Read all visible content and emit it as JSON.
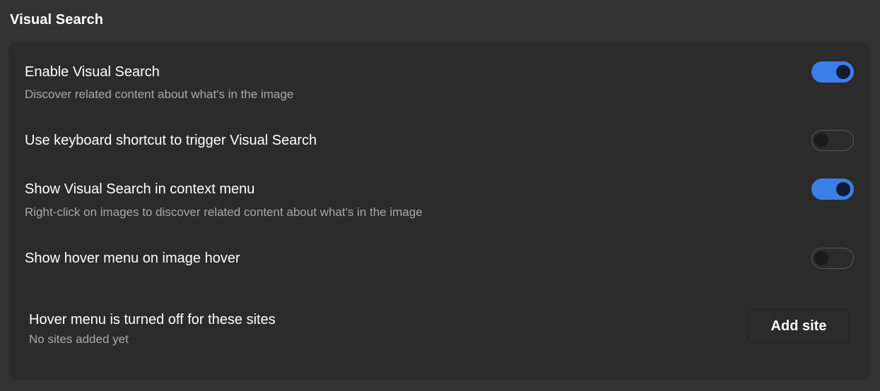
{
  "section": {
    "title": "Visual Search"
  },
  "settings": [
    {
      "title": "Enable Visual Search",
      "description": "Discover related content about what's in the image",
      "enabled": true
    },
    {
      "title": "Use keyboard shortcut to trigger Visual Search",
      "description": "",
      "enabled": false
    },
    {
      "title": "Show Visual Search in context menu",
      "description": "Right-click on images to discover related content about what's in the image",
      "enabled": true
    },
    {
      "title": "Show hover menu on image hover",
      "description": "",
      "enabled": false
    }
  ],
  "hover_menu": {
    "title": "Hover menu is turned off for these sites",
    "status": "No sites added yet",
    "add_label": "Add site"
  },
  "colors": {
    "accent": "#3b7ee8",
    "knob_on": "#0f1a33",
    "background": "#333333",
    "card": "#2b2b2b",
    "secondary_text": "#a9a9a9"
  }
}
